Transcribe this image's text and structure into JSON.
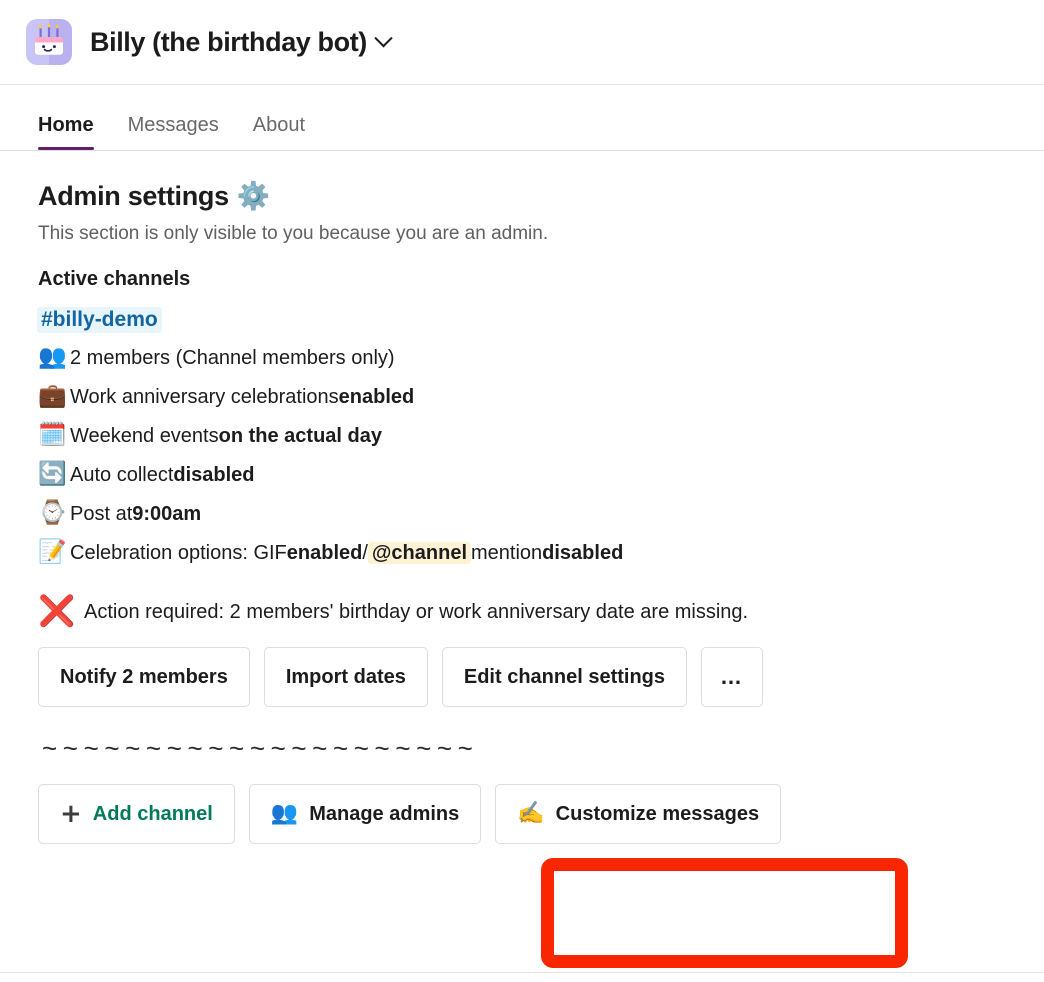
{
  "header": {
    "app_name": "Billy (the birthday bot)",
    "icon_name": "birthday-cake-app-icon",
    "chevron_name": "chevron-down-icon"
  },
  "tabs": [
    {
      "label": "Home",
      "active": true
    },
    {
      "label": "Messages",
      "active": false
    },
    {
      "label": "About",
      "active": false
    }
  ],
  "admin": {
    "title": "Admin settings",
    "title_emoji": "⚙️",
    "subtitle": "This section is only visible to you because you are an admin.",
    "active_channels_heading": "Active channels",
    "channel": "#billy-demo",
    "details": [
      {
        "icon": "👥",
        "icon_name": "members-emoji",
        "pre": "2 members (Channel members only)",
        "bold": "",
        "post": ""
      },
      {
        "icon": "💼",
        "icon_name": "briefcase-emoji",
        "pre": "Work anniversary celebrations ",
        "bold": "enabled",
        "post": ""
      },
      {
        "icon": "🗓️",
        "icon_name": "calendar-emoji",
        "pre": "Weekend events ",
        "bold": "on the actual day",
        "post": ""
      },
      {
        "icon": "🔄",
        "icon_name": "auto-collect-emoji",
        "pre": "Auto collect ",
        "bold": "disabled",
        "post": ""
      },
      {
        "icon": "⌚",
        "icon_name": "watch-emoji",
        "pre": "Post at ",
        "bold": "9:00am",
        "post": ""
      }
    ],
    "celebration_row": {
      "icon": "📝",
      "icon_name": "memo-emoji",
      "pre": "Celebration options: GIF ",
      "bold1": "enabled",
      "slash": " / ",
      "mention": "@channel",
      "mid": " mention ",
      "bold2": "disabled"
    },
    "action_required": {
      "icon": "❌",
      "icon_name": "cross-mark-emoji",
      "text": "Action required: 2 members' birthday or work anniversary date are missing."
    },
    "action_buttons": [
      {
        "label": "Notify 2 members",
        "name": "notify-members-button"
      },
      {
        "label": "Import dates",
        "name": "import-dates-button"
      },
      {
        "label": "Edit channel settings",
        "name": "edit-channel-settings-button"
      },
      {
        "label": "…",
        "name": "more-options-button"
      }
    ],
    "divider": "~~~~~~~~~~~~~~~~~~~~~",
    "footer_buttons": [
      {
        "label": "Add channel",
        "icon": "+",
        "icon_name": "plus-icon",
        "name": "add-channel-button"
      },
      {
        "label": "Manage admins",
        "icon": "👥",
        "icon_name": "members-emoji",
        "name": "manage-admins-button"
      },
      {
        "label": "Customize messages",
        "icon": "✍️",
        "icon_name": "writing-hand-emoji",
        "name": "customize-messages-button"
      }
    ]
  },
  "annotation": {
    "color": "#fa2600",
    "target": "customize-messages-button"
  },
  "colors": {
    "accent_purple": "#611f69",
    "link_blue": "#1264a3",
    "link_bg": "#e8f5fb",
    "green": "#007a5a",
    "mention_bg": "#fdf3d4",
    "red": "#e8252a"
  }
}
